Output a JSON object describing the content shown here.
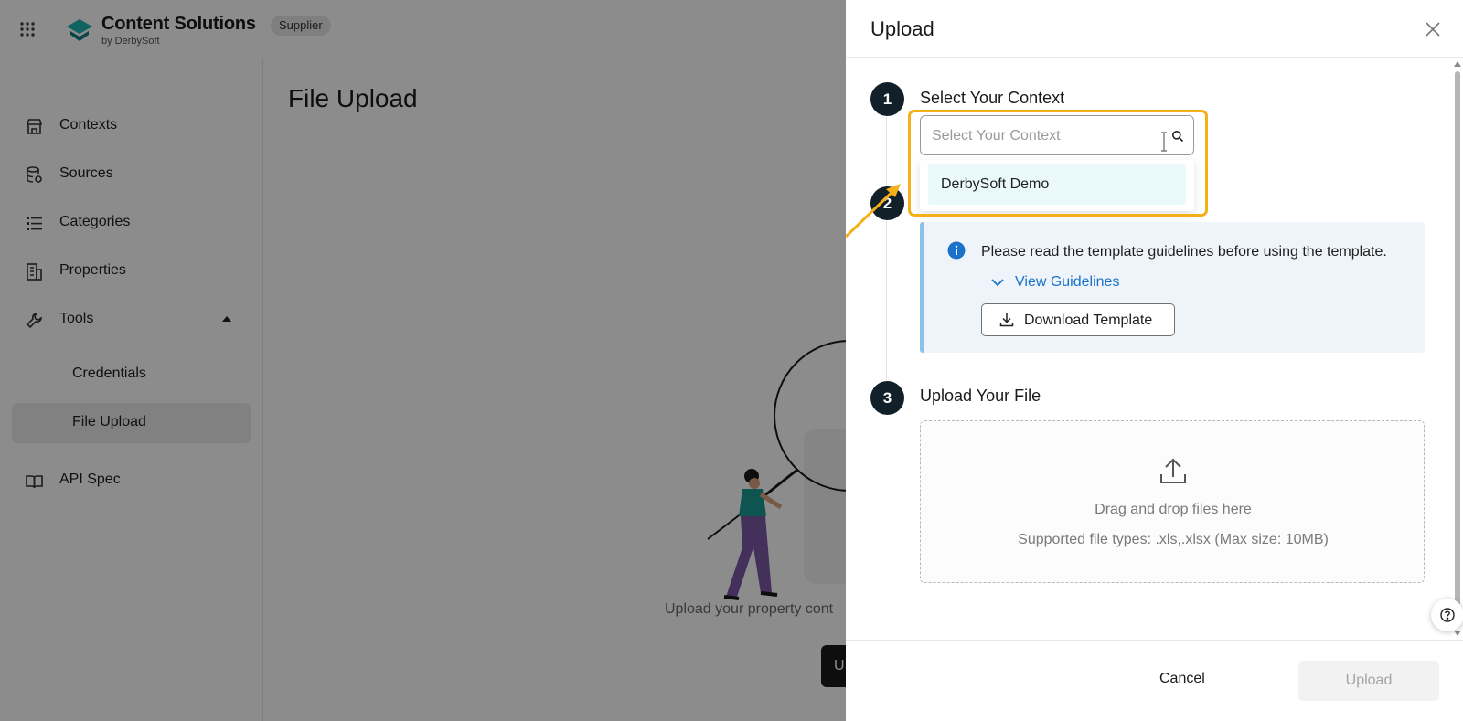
{
  "topbar": {
    "brand_title": "Content Solutions",
    "brand_subtitle": "by DerbySoft",
    "badge": "Supplier",
    "logo_color": "#1db5b3"
  },
  "sidebar": {
    "items": [
      {
        "label": "Contexts",
        "icon": "storefront-icon"
      },
      {
        "label": "Sources",
        "icon": "database-icon"
      },
      {
        "label": "Categories",
        "icon": "list-icon"
      },
      {
        "label": "Properties",
        "icon": "building-icon"
      },
      {
        "label": "Tools",
        "icon": "wrench-icon",
        "expanded": true
      },
      {
        "label": "API Spec",
        "icon": "book-icon"
      }
    ],
    "sub_items": [
      {
        "label": "Credentials"
      },
      {
        "label": "File Upload",
        "active": true
      }
    ]
  },
  "main": {
    "title": "File Upload",
    "empty_text": "Upload your property cont",
    "upload_button_label": "U"
  },
  "drawer": {
    "title": "Upload",
    "steps": [
      {
        "number": "1",
        "title": "Select Your Context"
      },
      {
        "number": "2",
        "title": ""
      },
      {
        "number": "3",
        "title": "Upload Your File"
      }
    ],
    "context_select": {
      "placeholder": "Select Your Context",
      "value": "",
      "options": [
        "DerbySoft Demo"
      ]
    },
    "info": {
      "text": "Please read the template guidelines before using the template.",
      "guidelines_link": "View Guidelines",
      "download_label": "Download Template"
    },
    "dropzone": {
      "primary": "Drag and drop files here",
      "secondary": "Supported file types: .xls,.xlsx (Max size: 10MB)"
    },
    "footer": {
      "cancel_label": "Cancel",
      "upload_label": "Upload"
    }
  },
  "colors": {
    "highlight": "#f5b019",
    "step_badge": "#12202a",
    "link": "#1a73c8",
    "info_bg": "#eef4fa"
  }
}
